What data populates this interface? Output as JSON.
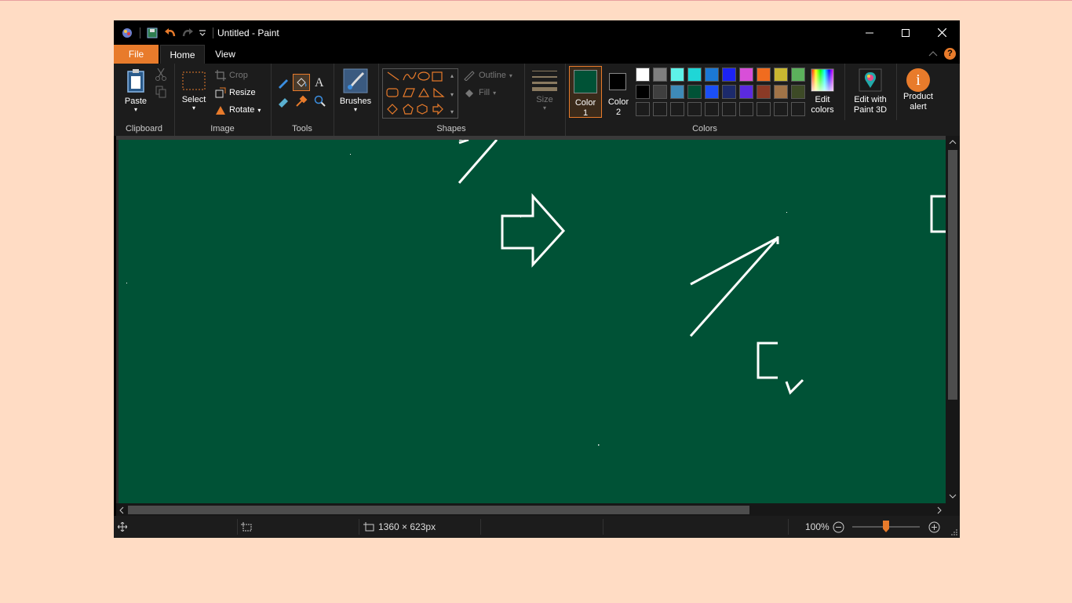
{
  "window": {
    "title": "Untitled - Paint",
    "controls": {
      "minimize": "─",
      "maximize": "☐",
      "close": "✕"
    }
  },
  "menu": {
    "file": "File",
    "tabs": [
      "Home",
      "View"
    ],
    "help": "?"
  },
  "ribbon": {
    "clipboard": {
      "label": "Clipboard",
      "paste": "Paste"
    },
    "image": {
      "label": "Image",
      "select": "Select",
      "crop": "Crop",
      "resize": "Resize",
      "rotate": "Rotate"
    },
    "tools": {
      "label": "Tools"
    },
    "brushes": {
      "label": "Brushes"
    },
    "shapes": {
      "label": "Shapes",
      "outline": "Outline",
      "fill": "Fill"
    },
    "size": {
      "label": "Size"
    },
    "colors": {
      "label": "Colors",
      "color1": "Color\n1",
      "color2": "Color\n2",
      "color1_value": "#005236",
      "color2_value": "#000000",
      "palette_row1": [
        "#ffffff",
        "#7f7f7f",
        "#5ef2e8",
        "#1fd6d6",
        "#1b78d4",
        "#1c23f5",
        "#d84fd8",
        "#f06c1f",
        "#c9b731",
        "#5cb05c"
      ],
      "palette_row2": [
        "#000000",
        "#3f3f3f",
        "#3e8ab7",
        "#005236",
        "#1b4ff5",
        "#1c2a6b",
        "#5b2ae0",
        "#8b3a26",
        "#a07448",
        "#3d4a26"
      ],
      "edit_colors": "Edit\ncolors",
      "paint3d": "Edit with\nPaint 3D",
      "product_alert": "Product\nalert"
    }
  },
  "canvas": {
    "background": "#005236",
    "stroke": "#ffffff"
  },
  "status": {
    "dimensions": "1360 × 623px",
    "zoom": "100%"
  }
}
